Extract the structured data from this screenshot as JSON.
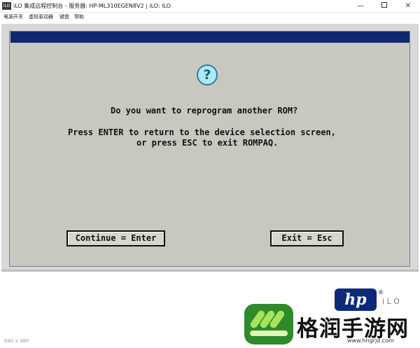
{
  "window": {
    "icon_text": "iLO",
    "title": "iLO 集成远程控制台 - 服务器: HP-ML310EGEN8V2 | iLO: ILO",
    "minimize": "—",
    "close": "✕"
  },
  "menu": {
    "items": [
      "电源开关",
      "虚拟驱动器",
      "键盘",
      "帮助"
    ]
  },
  "dialog": {
    "icon": "?",
    "question": "Do you want to reprogram another ROM?",
    "instruction_line1": "Press ENTER to return to the device selection screen,",
    "instruction_line2": "or press ESC to exit ROMPAQ.",
    "continue_button": "Continue = Enter",
    "exit_button": "Exit = Esc"
  },
  "status": {
    "resolution": "640 x 480"
  },
  "branding": {
    "hp": "hp",
    "hp_reg": "®",
    "ilo": "i L O"
  },
  "watermark": {
    "title": "格润手游网",
    "url": "www.hngrjd.com"
  },
  "colors": {
    "header_bar": "#10286e",
    "dialog_bg": "#c8c8c0",
    "hp_blue": "#0d2a7a",
    "watermark_green": "#2f8a2c"
  }
}
